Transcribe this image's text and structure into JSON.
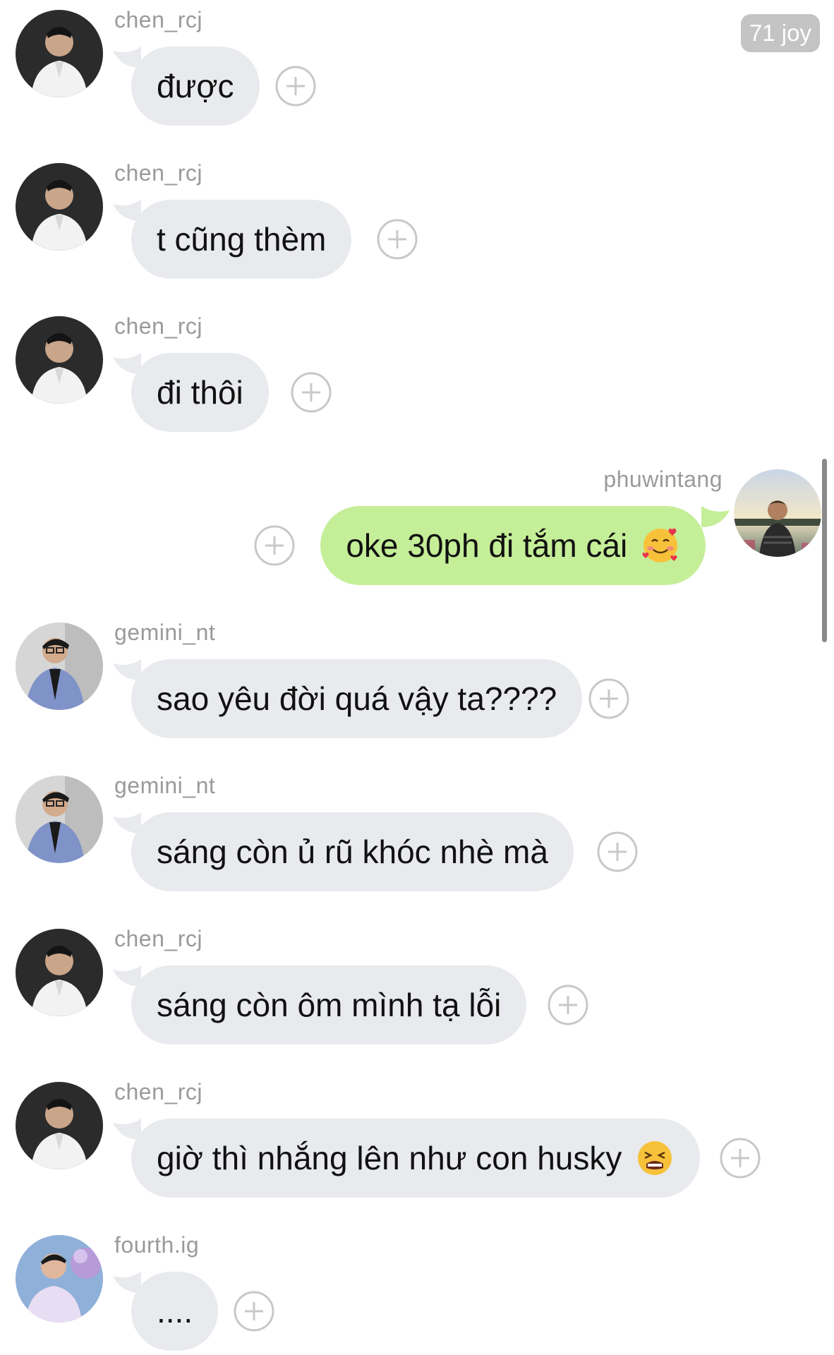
{
  "badge": {
    "label": "71 joy"
  },
  "messages": [
    {
      "sender": "chen_rcj",
      "text": "được",
      "avatar_icon": "avatar-chen-rcj-icon",
      "side": "left"
    },
    {
      "sender": "chen_rcj",
      "text": "t cũng thèm",
      "avatar_icon": "avatar-chen-rcj-icon",
      "side": "left"
    },
    {
      "sender": "chen_rcj",
      "text": "đi thôi",
      "avatar_icon": "avatar-chen-rcj-icon",
      "side": "left"
    },
    {
      "sender": "phuwintang",
      "text": "oke 30ph đi tắm cái",
      "emoji_icon": "smiling-face-with-hearts-icon",
      "avatar_icon": "avatar-phuwintang-icon",
      "side": "right"
    },
    {
      "sender": "gemini_nt",
      "text": "sao yêu đời quá vậy ta????",
      "avatar_icon": "avatar-gemini-nt-icon",
      "side": "left"
    },
    {
      "sender": "gemini_nt",
      "text": "sáng còn ủ rũ khóc nhè mà",
      "avatar_icon": "avatar-gemini-nt-icon",
      "side": "left"
    },
    {
      "sender": "chen_rcj",
      "text": "sáng còn ôm mình tạ lỗi",
      "avatar_icon": "avatar-chen-rcj-icon",
      "side": "left"
    },
    {
      "sender": "chen_rcj",
      "text": "giờ thì nhắng lên như con husky",
      "emoji_icon": "tired-face-icon",
      "avatar_icon": "avatar-chen-rcj-icon",
      "side": "left"
    },
    {
      "sender": "fourth.ig",
      "text": "....",
      "avatar_icon": "avatar-fourth-ig-icon",
      "side": "left"
    }
  ],
  "colors": {
    "incoming_bubble": "#e8eaed",
    "outgoing_bubble": "#c5ee98",
    "name_text": "#9a9a9a",
    "badge_bg": "#c4c4c4",
    "plus_icon": "#c8c8c8"
  }
}
